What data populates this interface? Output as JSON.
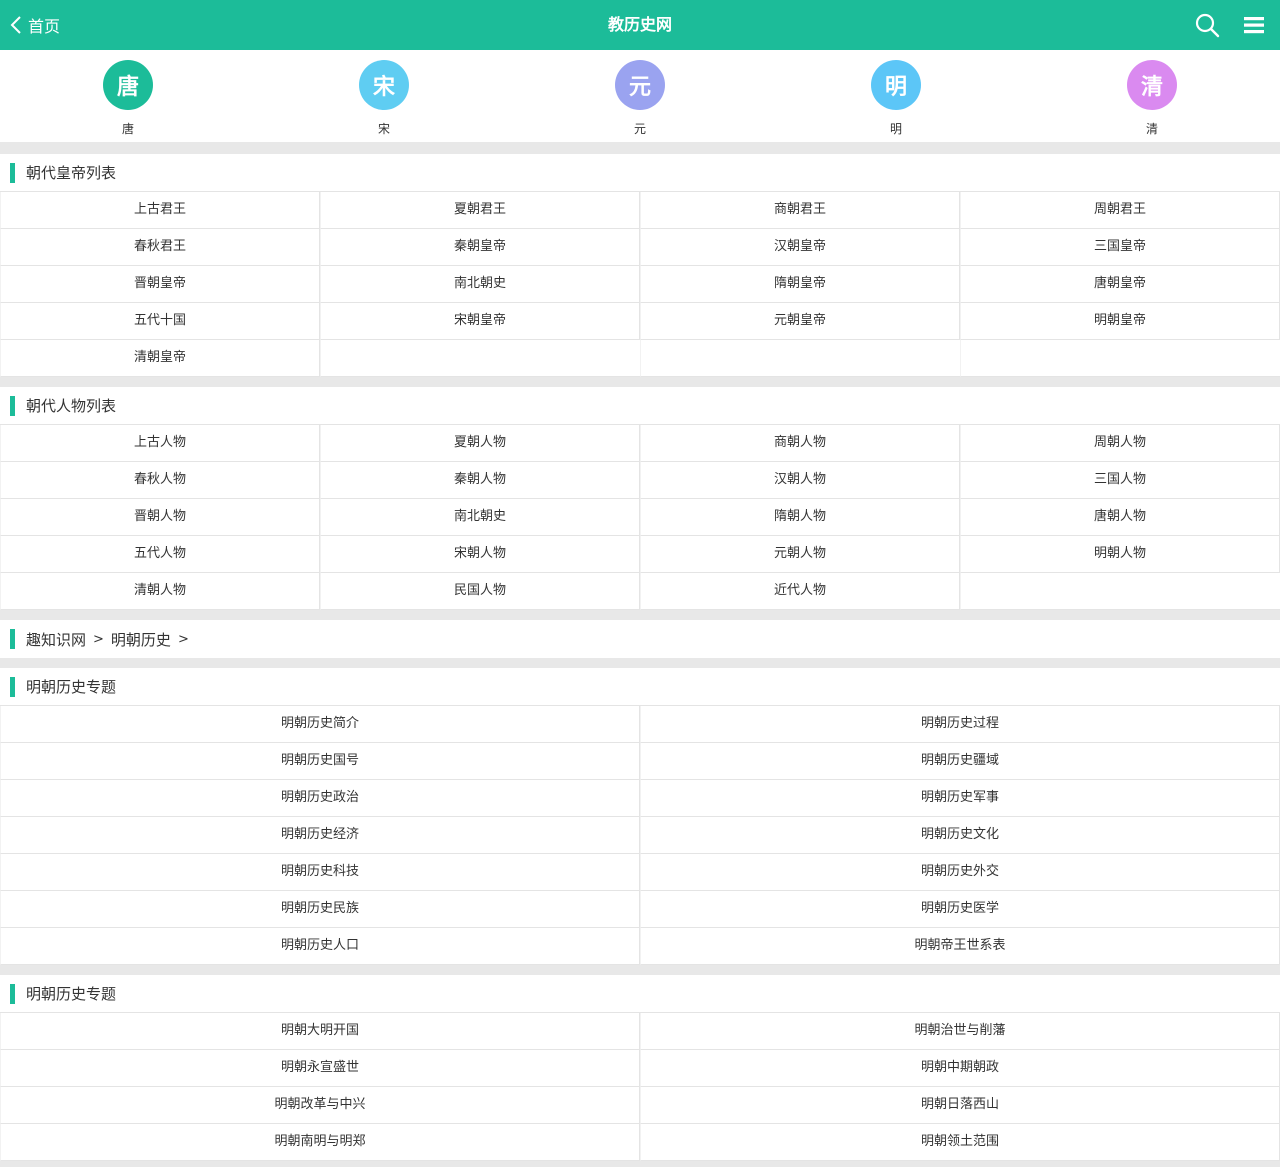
{
  "header": {
    "back_label": "首页",
    "site_title": "教历史网"
  },
  "dynasties": [
    {
      "char": "唐",
      "label": "唐",
      "color": "#1cbc99"
    },
    {
      "char": "宋",
      "label": "宋",
      "color": "#5fcdf2"
    },
    {
      "char": "元",
      "label": "元",
      "color": "#9aa3f0"
    },
    {
      "char": "明",
      "label": "明",
      "color": "#5cc6f7"
    },
    {
      "char": "清",
      "label": "清",
      "color": "#da8af0"
    }
  ],
  "emperors": {
    "title": "朝代皇帝列表",
    "items": [
      "上古君王",
      "夏朝君王",
      "商朝君王",
      "周朝君王",
      "春秋君王",
      "秦朝皇帝",
      "汉朝皇帝",
      "三国皇帝",
      "晋朝皇帝",
      "南北朝史",
      "隋朝皇帝",
      "唐朝皇帝",
      "五代十国",
      "宋朝皇帝",
      "元朝皇帝",
      "明朝皇帝",
      "清朝皇帝"
    ]
  },
  "figures": {
    "title": "朝代人物列表",
    "items": [
      "上古人物",
      "夏朝人物",
      "商朝人物",
      "周朝人物",
      "春秋人物",
      "秦朝人物",
      "汉朝人物",
      "三国人物",
      "晋朝人物",
      "南北朝史",
      "隋朝人物",
      "唐朝人物",
      "五代人物",
      "宋朝人物",
      "元朝人物",
      "明朝人物",
      "清朝人物",
      "民国人物",
      "近代人物"
    ]
  },
  "breadcrumb": {
    "root": "趣知识网",
    "sep": ">",
    "current": "明朝历史",
    "sep2": ">"
  },
  "topics1": {
    "title": "明朝历史专题",
    "items": [
      "明朝历史简介",
      "明朝历史过程",
      "明朝历史国号",
      "明朝历史疆域",
      "明朝历史政治",
      "明朝历史军事",
      "明朝历史经济",
      "明朝历史文化",
      "明朝历史科技",
      "明朝历史外交",
      "明朝历史民族",
      "明朝历史医学",
      "明朝历史人口",
      "明朝帝王世系表"
    ]
  },
  "topics2": {
    "title": "明朝历史专题",
    "items": [
      "明朝大明开国",
      "明朝治世与削藩",
      "明朝永宣盛世",
      "明朝中期朝政",
      "明朝改革与中兴",
      "明朝日落西山",
      "明朝南明与明郑",
      "明朝领土范围"
    ]
  }
}
